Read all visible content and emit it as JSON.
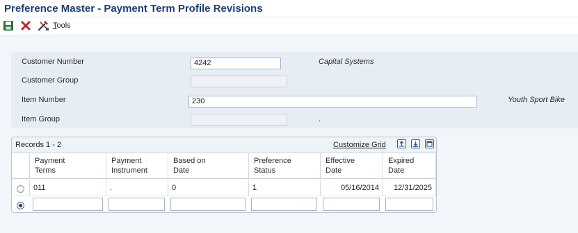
{
  "window": {
    "title": "Preference Master - Payment Term Profile Revisions"
  },
  "toolbar": {
    "ok_icon": "save-icon",
    "cancel_icon": "cancel-x-icon",
    "tools_icon": "tools-icon",
    "tools_label_hotkey": "T",
    "tools_label_rest": "ools"
  },
  "form": {
    "customer_number": {
      "label": "Customer Number",
      "value": "4242",
      "description": "Capital Systems"
    },
    "customer_group": {
      "label": "Customer Group",
      "value": ""
    },
    "item_number": {
      "label": "Item Number",
      "value": "230",
      "description": "Youth Sport Bike"
    },
    "item_group": {
      "label": "Item Group",
      "value": "",
      "description": "."
    }
  },
  "grid": {
    "records_label": "Records 1 - 2",
    "customize_label": "Customize Grid",
    "columns": [
      {
        "line1": "Payment",
        "line2": "Terms"
      },
      {
        "line1": "Payment",
        "line2": "Instrument"
      },
      {
        "line1": "Based on",
        "line2": "Date"
      },
      {
        "line1": "Preference",
        "line2": "Status"
      },
      {
        "line1": "Effective",
        "line2": "Date"
      },
      {
        "line1": "Expired",
        "line2": "Date"
      }
    ],
    "rows": [
      {
        "selected": false,
        "cells": [
          "011",
          ".",
          "0",
          "1",
          "05/16/2014",
          "12/31/2025"
        ]
      }
    ],
    "new_row_selected": true
  },
  "colors": {
    "title": "#1d3e70",
    "panel": "#e6edf4",
    "background": "#f2f5f9"
  }
}
